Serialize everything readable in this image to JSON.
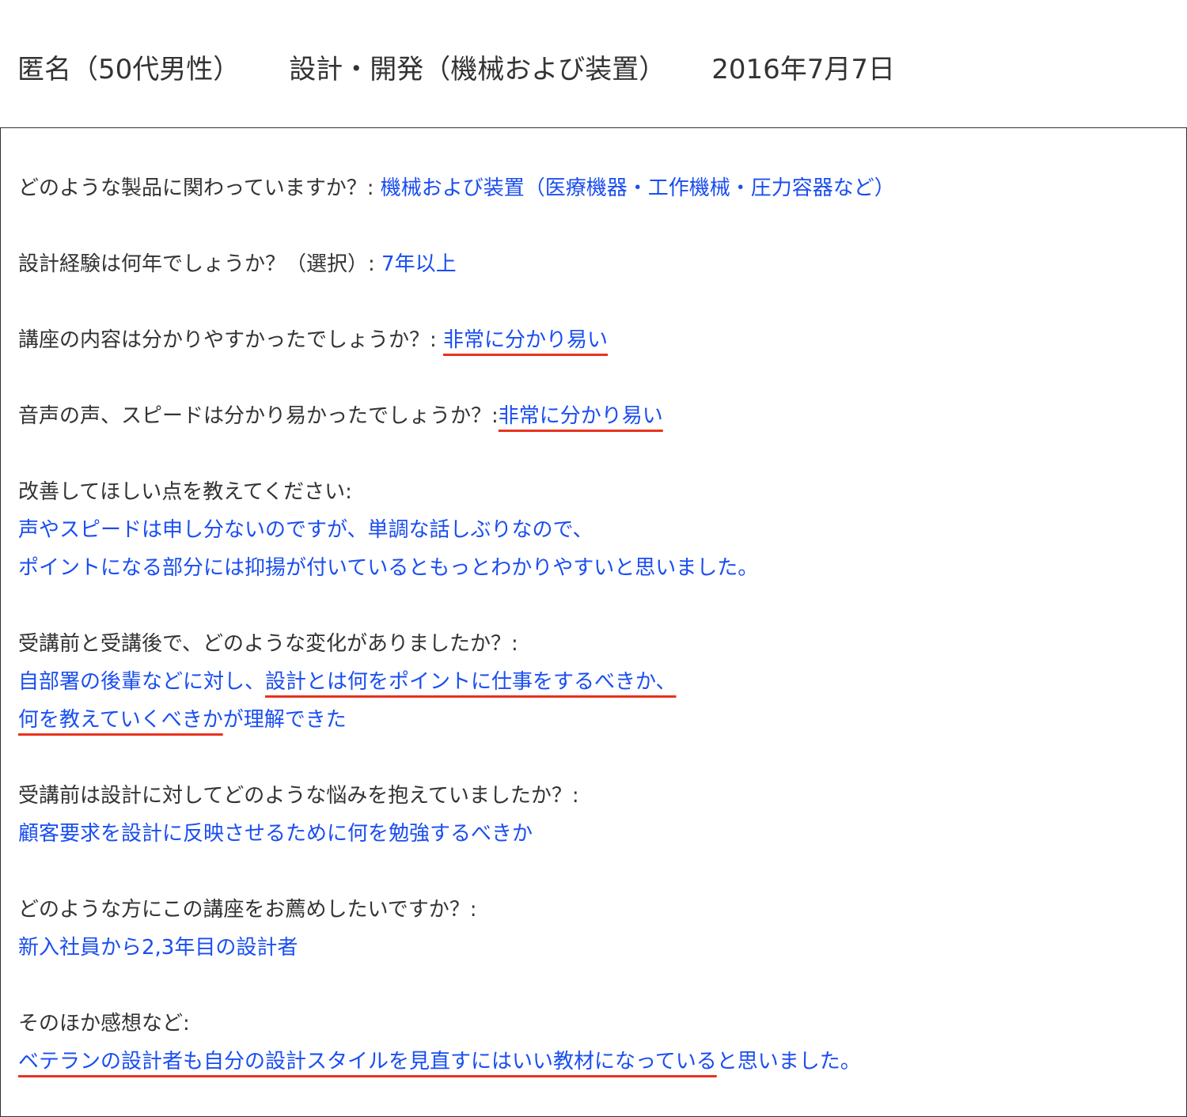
{
  "header": {
    "author": "匿名（50代男性）",
    "category": "設計・開発（機械および装置）",
    "date": "2016年7月7日"
  },
  "colors": {
    "question_text": "#333333",
    "answer_text": "#1a4ef0",
    "underline": "#e8321e",
    "border": "#333333"
  },
  "qa": {
    "products": {
      "question": "どのような製品に関わっていますか？: ",
      "answer": "機械および装置（医療機器・工作機械・圧力容器など）"
    },
    "experience": {
      "question": "設計経験は何年でしょうか？（選択）: ",
      "answer": "7年以上"
    },
    "content": {
      "question": "講座の内容は分かりやすかったでしょうか？: ",
      "answer": "非常に分かり易い"
    },
    "audio": {
      "question": "音声の声、スピードは分かり易かったでしょうか？:",
      "answer": "非常に分かり易い"
    },
    "improve": {
      "question": "改善してほしい点を教えてください:",
      "answer_line1": "声やスピードは申し分ないのですが、単調な話しぶりなので、",
      "answer_line2": "ポイントになる部分には抑揚が付いているともっとわかりやすいと思いました。"
    },
    "change": {
      "question": "受講前と受講後で、どのような変化がありましたか？:",
      "answer_line1_plain": "自部署の後輩などに対し、",
      "answer_line1_highlight": "設計とは何をポイントに仕事をするべきか、",
      "answer_line2_highlight": "何を教えていくべきか",
      "answer_line2_plain": "が理解できた"
    },
    "concern": {
      "question": "受講前は設計に対してどのような悩みを抱えていましたか？:",
      "answer": "顧客要求を設計に反映させるために何を勉強するべきか"
    },
    "recommend": {
      "question": "どのような方にこの講座をお薦めしたいですか？:",
      "answer": "新入社員から2,3年目の設計者"
    },
    "other": {
      "question": "そのほか感想など:",
      "answer_highlight": "ベテランの設計者も自分の設計スタイルを見直すにはいい教材になっている",
      "answer_plain": "と思いました。"
    }
  }
}
